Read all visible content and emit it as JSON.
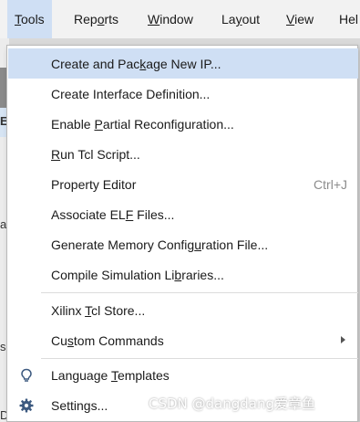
{
  "menubar": {
    "items": [
      {
        "mnemonic": "T",
        "rest": "ools",
        "active": true
      },
      {
        "prefix": "Rep",
        "mnemonic": "o",
        "rest": "rts"
      },
      {
        "mnemonic": "W",
        "rest": "indow"
      },
      {
        "prefix": "La",
        "mnemonic": "y",
        "rest": "out"
      },
      {
        "mnemonic": "V",
        "rest": "iew"
      },
      {
        "prefix": "Hel",
        "mnemonic": "",
        "rest": ""
      }
    ]
  },
  "background_fragments": [
    "E",
    "a",
    "si",
    "De"
  ],
  "tools_menu": {
    "items": [
      {
        "prefix": "Create and Pac",
        "mnemonic": "k",
        "rest": "age New IP..."
      },
      {
        "prefix": "Create Interface Definition...",
        "mnemonic": "",
        "rest": ""
      },
      {
        "prefix": "Enable ",
        "mnemonic": "P",
        "rest": "artial Reconfiguration..."
      },
      {
        "prefix": "",
        "mnemonic": "R",
        "rest": "un Tcl Script..."
      },
      {
        "prefix": "Property Editor",
        "mnemonic": "",
        "rest": "",
        "shortcut": "Ctrl+J"
      },
      {
        "prefix": "Associate EL",
        "mnemonic": "F",
        "rest": " Files..."
      },
      {
        "prefix": "Generate Memory Config",
        "mnemonic": "u",
        "rest": "ration File..."
      },
      {
        "prefix": "Compile Simulation Li",
        "mnemonic": "b",
        "rest": "raries..."
      },
      {
        "prefix": "Xilinx ",
        "mnemonic": "T",
        "rest": "cl Store..."
      },
      {
        "prefix": "Cu",
        "mnemonic": "s",
        "rest": "tom Commands"
      },
      {
        "prefix": "Language ",
        "mnemonic": "T",
        "rest": "emplates",
        "icon": "lightbulb-icon"
      },
      {
        "prefix": "Settings...",
        "mnemonic": "",
        "rest": "",
        "icon": "gear-icon"
      }
    ]
  },
  "watermark": "CSDN @dangdang爱章鱼",
  "colors": {
    "highlight": "#cfdff4",
    "menubar_bg": "#f2f2f2",
    "shortcut_text": "#8c8c8c",
    "icon": "#3d5a80"
  }
}
